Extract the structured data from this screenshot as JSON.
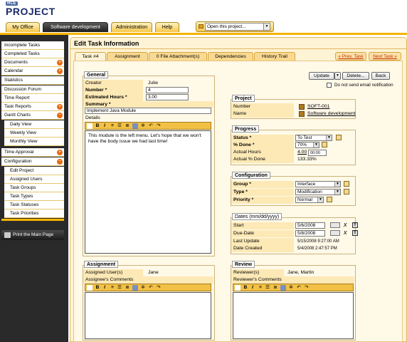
{
  "app": {
    "logo_small": "RCE",
    "logo_big": "PROJECT"
  },
  "main_tabs": [
    {
      "label": "My Office"
    },
    {
      "label": "Software development"
    },
    {
      "label": "Administration"
    },
    {
      "label": "Help"
    }
  ],
  "project_select": {
    "value": "Open this project..."
  },
  "sidebar": {
    "items": [
      {
        "label": "Incomplete Tasks"
      },
      {
        "label": "Completed Tasks"
      },
      {
        "label": "Documents"
      },
      {
        "label": "Calendar"
      },
      {
        "label": "Statistics"
      },
      {
        "label": "Discussion Forum"
      },
      {
        "label": "Time Report"
      },
      {
        "label": "Task Reports"
      },
      {
        "label": "Gantt Charts"
      },
      {
        "label": "Daily View"
      },
      {
        "label": "Weekly View"
      },
      {
        "label": "Monthly View"
      },
      {
        "label": "Time Approval"
      },
      {
        "label": "Configuration"
      },
      {
        "label": "Edit Project"
      },
      {
        "label": "Assigned Users"
      },
      {
        "label": "Task Groups"
      },
      {
        "label": "Task Types"
      },
      {
        "label": "Task Statuses"
      },
      {
        "label": "Task Priorities"
      }
    ],
    "print_label": "Print the Main Page"
  },
  "page": {
    "title": "Edit Task Information",
    "tabs": [
      {
        "label": "Task #4"
      },
      {
        "label": "Assignment"
      },
      {
        "label": "0 File Attachment(s)"
      },
      {
        "label": "Dependencies"
      },
      {
        "label": "History Trail"
      }
    ],
    "prev_label": "Prev. Task",
    "next_label": "Next Task"
  },
  "actions": {
    "update": "Update",
    "delete": "Delete...",
    "back": "Back",
    "no_email": "Do not send email notification"
  },
  "general": {
    "legend": "General",
    "creator_label": "Creator",
    "creator_value": "Julie",
    "number_label": "Number *",
    "number_value": "4",
    "hours_label": "Estimated Hours *",
    "hours_value": "3.00",
    "summary_label": "Summary *",
    "summary_value": "Implement Java Module",
    "details_label": "Details",
    "details_text": "This module is the left menu. Let's hope that we won't have the body issue we had last time!"
  },
  "project": {
    "legend": "Project",
    "number_label": "Number",
    "number_value": "SOFT-001",
    "name_label": "Name",
    "name_value": "Software development"
  },
  "progress": {
    "legend": "Progress",
    "status_label": "Status *",
    "status_value": "To Test",
    "done_label": "% Done *",
    "done_value": "70%",
    "actual_hours_label": "Actual Hours",
    "actual_hours_value": "4.00",
    "timer_value": "00:00",
    "actual_done_label": "Actual % Done",
    "actual_done_value": "133.33%"
  },
  "configuration": {
    "legend": "Configuration",
    "group_label": "Group *",
    "group_value": "Interface",
    "type_label": "Type *",
    "type_value": "Modification",
    "priority_label": "Priority *",
    "priority_value": "Normal"
  },
  "dates": {
    "legend": "Dates (mm/dd/yyyy)",
    "start_label": "Start",
    "start_value": "5/6/2008",
    "due_label": "Due-Date",
    "due_value": "5/8/2008",
    "update_label": "Last Update",
    "update_value": "5/15/2008 9:27:00 AM",
    "created_label": "Date Created",
    "created_value": "5/4/2008 2:47:57 PM"
  },
  "assignment": {
    "legend": "Assignment",
    "users_label": "Assigned User(s)",
    "users_value": "Jane",
    "comments_label": "Assignee's Comments"
  },
  "review": {
    "legend": "Review",
    "reviewers_label": "Reviewer(s)",
    "reviewers_value": "Jane, Martin",
    "comments_label": "Reviewer's Comments"
  },
  "colors": {
    "accent": "#f5b400",
    "plus": "#e86a10",
    "sidebar_bg": "#2a2a2a"
  }
}
